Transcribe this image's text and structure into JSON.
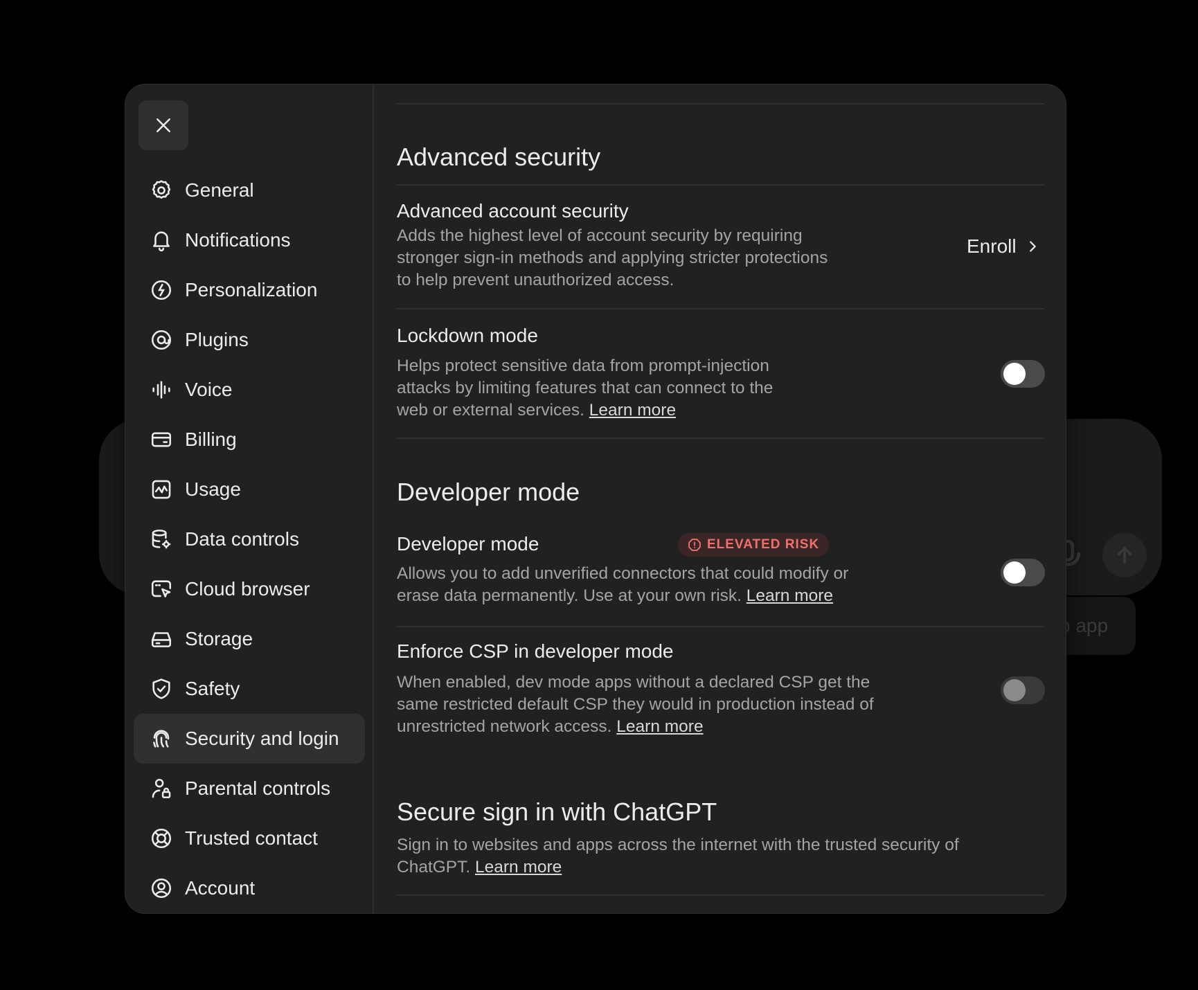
{
  "background": {
    "pill_text": "p app"
  },
  "sidebar": {
    "items": [
      {
        "label": "General",
        "icon": "gear-icon"
      },
      {
        "label": "Notifications",
        "icon": "bell-icon"
      },
      {
        "label": "Personalization",
        "icon": "personalization-icon"
      },
      {
        "label": "Plugins",
        "icon": "plugins-icon"
      },
      {
        "label": "Voice",
        "icon": "voice-icon"
      },
      {
        "label": "Billing",
        "icon": "credit-card-icon"
      },
      {
        "label": "Usage",
        "icon": "usage-chart-icon"
      },
      {
        "label": "Data controls",
        "icon": "database-gear-icon"
      },
      {
        "label": "Cloud browser",
        "icon": "cloud-browser-icon"
      },
      {
        "label": "Storage",
        "icon": "storage-drive-icon"
      },
      {
        "label": "Safety",
        "icon": "shield-check-icon"
      },
      {
        "label": "Security and login",
        "icon": "fingerprint-icon",
        "active": true
      },
      {
        "label": "Parental controls",
        "icon": "person-lock-icon"
      },
      {
        "label": "Trusted contact",
        "icon": "lifebuoy-icon"
      },
      {
        "label": "Account",
        "icon": "user-circle-icon"
      }
    ]
  },
  "advanced_security": {
    "title": "Advanced security",
    "account": {
      "title": "Advanced account security",
      "description": "Adds the highest level of account security by requiring stronger sign-in methods and applying stricter protections to help prevent unauthorized access.",
      "action": "Enroll"
    },
    "lockdown": {
      "title": "Lockdown mode",
      "description": "Helps protect sensitive data from prompt-injection attacks by limiting features that can connect to the web or external services. ",
      "link": "Learn more",
      "enabled": false
    }
  },
  "developer_mode": {
    "title": "Developer mode",
    "row": {
      "title": "Developer mode",
      "badge": "ELEVATED RISK",
      "description": "Allows you to add unverified connectors that could modify or erase data permanently. Use at your own risk. ",
      "link": "Learn more",
      "enabled": false
    },
    "csp": {
      "title": "Enforce CSP in developer mode",
      "description": "When enabled, dev mode apps without a declared CSP get the same restricted default CSP they would in production instead of unrestricted network access. ",
      "link": "Learn more",
      "enabled": false,
      "disabled": true
    }
  },
  "secure_sign_in": {
    "title": "Secure sign in with ChatGPT",
    "description": "Sign in to websites and apps across the internet with the trusted security of ChatGPT. ",
    "link": "Learn more"
  },
  "colors": {
    "modal_bg": "#212121",
    "active_item_bg": "#303030",
    "badge_text": "#f0716b",
    "badge_bg": "#3a2626"
  }
}
